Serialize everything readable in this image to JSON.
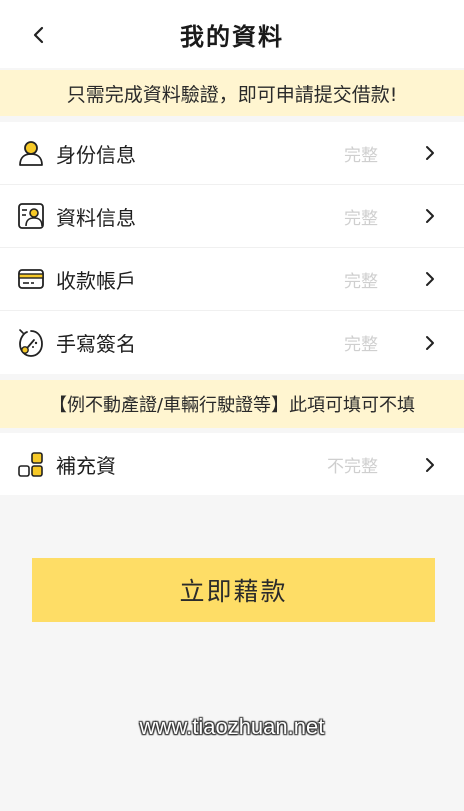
{
  "header": {
    "title": "我的資料",
    "back_icon": "chevron-left-icon"
  },
  "notice_top": "只需完成資料驗證，即可申請提交借款!",
  "items": [
    {
      "label": "身份信息",
      "status": "完整",
      "icon": "person-icon"
    },
    {
      "label": "資料信息",
      "status": "完整",
      "icon": "id-card-icon"
    },
    {
      "label": "收款帳戶",
      "status": "完整",
      "icon": "bank-card-icon"
    },
    {
      "label": "手寫簽名",
      "status": "完整",
      "icon": "signature-icon"
    }
  ],
  "notice_mid": "【例不動產證/車輛行駛證等】此項可填可不填",
  "extra_item": {
    "label": "補充資",
    "status": "不完整",
    "icon": "blocks-icon"
  },
  "submit_label": "立即藉款",
  "watermark": "www.tiaozhuan.net",
  "colors": {
    "accent": "#fedd66",
    "notice_bg": "#fff5d0",
    "icon_yellow": "#f6c928",
    "page_bg": "#f6f6f6"
  }
}
